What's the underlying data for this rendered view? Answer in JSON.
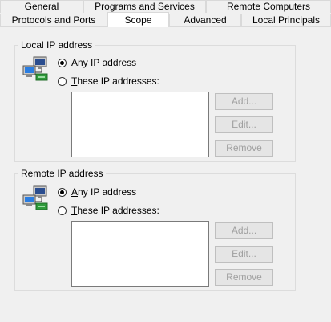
{
  "tabs_row1": [
    {
      "label": "General"
    },
    {
      "label": "Programs and Services"
    },
    {
      "label": "Remote Computers"
    }
  ],
  "tabs_row2": [
    {
      "label": "Protocols and Ports"
    },
    {
      "label": "Scope",
      "active": true
    },
    {
      "label": "Advanced"
    },
    {
      "label": "Local Principals"
    }
  ],
  "local": {
    "title": "Local IP address",
    "any_first": "A",
    "any_rest": "ny IP address",
    "these_first": "T",
    "these_rest": "hese IP addresses:",
    "add": "Add...",
    "edit": "Edit...",
    "remove": "Remove"
  },
  "remote": {
    "title": "Remote IP address",
    "any_first": "A",
    "any_rest": "ny IP address",
    "these_first": "T",
    "these_rest": "hese IP addresses:",
    "add": "Add...",
    "edit": "Edit...",
    "remove": "Remove"
  },
  "icons": {
    "network": "network-computers-icon"
  }
}
